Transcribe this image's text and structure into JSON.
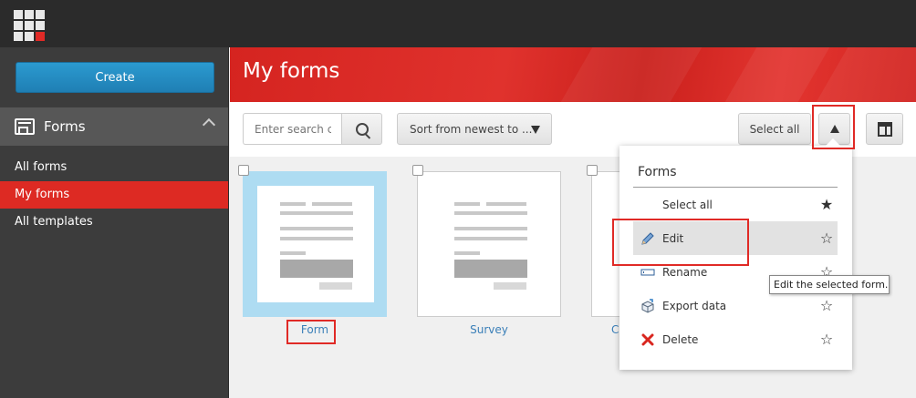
{
  "sidebar": {
    "create_label": "Create",
    "section_title": "Forms",
    "items": [
      {
        "label": "All forms"
      },
      {
        "label": "My forms"
      },
      {
        "label": "All templates"
      }
    ]
  },
  "header": {
    "title": "My forms"
  },
  "toolbar": {
    "search_placeholder": "Enter search cr",
    "sort_label": "Sort from newest to ...",
    "select_all_label": "Select all"
  },
  "cards": [
    {
      "label": "Form"
    },
    {
      "label": "Survey"
    },
    {
      "label": "C"
    }
  ],
  "dropdown": {
    "title": "Forms",
    "items": [
      {
        "label": "Select all",
        "icon": "none",
        "star": "★"
      },
      {
        "label": "Edit",
        "icon": "pencil-icon",
        "star": "☆"
      },
      {
        "label": "Rename",
        "icon": "rename-icon",
        "star": "☆"
      },
      {
        "label": "Export data",
        "icon": "export-box-icon",
        "star": "☆"
      },
      {
        "label": "Delete",
        "icon": "delete-x-icon",
        "star": "☆"
      }
    ]
  },
  "tooltip": "Edit the selected form.",
  "colors": {
    "accent_red": "#dd2a23",
    "create_blue": "#2b9ad0",
    "link_blue": "#3a7fb8",
    "selected_card": "#aedcf2"
  }
}
